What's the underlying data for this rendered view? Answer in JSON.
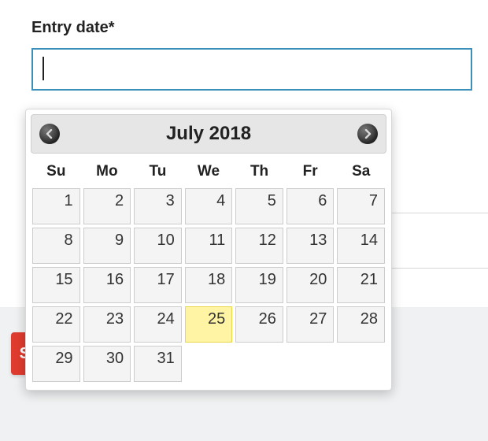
{
  "field": {
    "label": "Entry date*",
    "value": "",
    "placeholder": ""
  },
  "calendar": {
    "month_year": "July 2018",
    "days_of_week": [
      "Su",
      "Mo",
      "Tu",
      "We",
      "Th",
      "Fr",
      "Sa"
    ],
    "blanks_before": 0,
    "days": [
      1,
      2,
      3,
      4,
      5,
      6,
      7,
      8,
      9,
      10,
      11,
      12,
      13,
      14,
      15,
      16,
      17,
      18,
      19,
      20,
      21,
      22,
      23,
      24,
      25,
      26,
      27,
      28,
      29,
      30,
      31
    ],
    "today": 25
  },
  "submit_fragment": "S"
}
